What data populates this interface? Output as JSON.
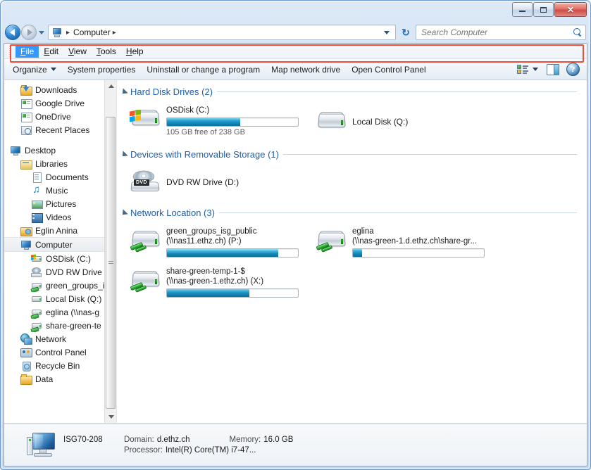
{
  "window": {
    "controls": {
      "minimize": "minimize-button",
      "maximize": "maximize-button",
      "close": "✕"
    }
  },
  "addressbar": {
    "back_tooltip": "Back",
    "forward_tooltip": "Forward",
    "crumb_root": "Computer",
    "refresh_glyph": "↻"
  },
  "search": {
    "placeholder": "Search Computer",
    "value": ""
  },
  "menubar": {
    "items": [
      {
        "label": "File",
        "accel": "F",
        "rest": "ile",
        "active": true
      },
      {
        "label": "Edit",
        "accel": "E",
        "rest": "dit",
        "active": false
      },
      {
        "label": "View",
        "accel": "V",
        "rest": "iew",
        "active": false
      },
      {
        "label": "Tools",
        "accel": "T",
        "rest": "ools",
        "active": false
      },
      {
        "label": "Help",
        "accel": "H",
        "rest": "elp",
        "active": false
      }
    ],
    "highlight_color": "#3399ff",
    "annotation_color": "#f04a3a"
  },
  "toolbar": {
    "organize": "Organize",
    "system_properties": "System properties",
    "uninstall": "Uninstall or change a program",
    "map_network_drive": "Map network drive",
    "open_control_panel": "Open Control Panel",
    "help_glyph": "?"
  },
  "sidebar": {
    "items": [
      {
        "label": "Downloads",
        "icon": "downloads-folder-icon",
        "indent": 1,
        "type": "dl"
      },
      {
        "label": "Google Drive",
        "icon": "google-drive-icon",
        "indent": 1,
        "type": "app"
      },
      {
        "label": "OneDrive",
        "icon": "onedrive-icon",
        "indent": 1,
        "type": "app"
      },
      {
        "label": "Recent Places",
        "icon": "recent-places-icon",
        "indent": 1,
        "type": "recent"
      },
      {
        "label": "",
        "icon": "",
        "indent": 0,
        "type": "gap"
      },
      {
        "label": "Desktop",
        "icon": "desktop-icon",
        "indent": 0,
        "type": "monitor"
      },
      {
        "label": "Libraries",
        "icon": "libraries-icon",
        "indent": 1,
        "type": "library"
      },
      {
        "label": "Documents",
        "icon": "documents-icon",
        "indent": 2,
        "type": "doc"
      },
      {
        "label": "Music",
        "icon": "music-icon",
        "indent": 2,
        "type": "music"
      },
      {
        "label": "Pictures",
        "icon": "pictures-icon",
        "indent": 2,
        "type": "pic"
      },
      {
        "label": "Videos",
        "icon": "videos-icon",
        "indent": 2,
        "type": "vid"
      },
      {
        "label": "Eglin  Anina",
        "icon": "user-folder-icon",
        "indent": 1,
        "type": "user"
      },
      {
        "label": "Computer",
        "icon": "computer-icon",
        "indent": 1,
        "type": "monitor",
        "selected": true
      },
      {
        "label": "OSDisk (C:)",
        "icon": "os-disk-icon",
        "indent": 2,
        "type": "hdd-win"
      },
      {
        "label": "DVD RW Drive (",
        "icon": "dvd-drive-icon",
        "indent": 2,
        "type": "dvd"
      },
      {
        "label": "green_groups_i",
        "icon": "network-drive-icon",
        "indent": 2,
        "type": "hdd-net"
      },
      {
        "label": "Local Disk (Q:)",
        "icon": "local-disk-icon",
        "indent": 2,
        "type": "hdd"
      },
      {
        "label": "eglina (\\\\nas-g",
        "icon": "network-drive-icon",
        "indent": 2,
        "type": "hdd-net"
      },
      {
        "label": "share-green-te",
        "icon": "network-drive-icon",
        "indent": 2,
        "type": "hdd-net"
      },
      {
        "label": "Network",
        "icon": "network-globe-icon",
        "indent": 1,
        "type": "globe"
      },
      {
        "label": "Control Panel",
        "icon": "control-panel-icon",
        "indent": 1,
        "type": "cpanel"
      },
      {
        "label": "Recycle Bin",
        "icon": "recycle-bin-icon",
        "indent": 1,
        "type": "bin"
      },
      {
        "label": "Data",
        "icon": "data-folder-icon",
        "indent": 1,
        "type": "folder"
      }
    ]
  },
  "content": {
    "sections": [
      {
        "title": "Hard Disk Drives (2)",
        "items": [
          {
            "name": "OSDisk (C:)",
            "icon": "os-disk-icon",
            "progress": 56,
            "sub": "105 GB free of 238 GB",
            "has_progress": true
          },
          {
            "name": "Local Disk (Q:)",
            "icon": "local-disk-icon",
            "has_progress": false
          }
        ]
      },
      {
        "title": "Devices with Removable Storage (1)",
        "items": [
          {
            "name": "DVD RW Drive (D:)",
            "icon": "dvd-drive-icon",
            "badge": "DVD",
            "has_progress": false
          }
        ]
      },
      {
        "title": "Network Location (3)",
        "items": [
          {
            "name": "green_groups_isg_public",
            "name2": "(\\\\nas11.ethz.ch) (P:)",
            "icon": "network-drive-icon",
            "progress": 85,
            "has_progress": true
          },
          {
            "name": "eglina",
            "name2": "(\\\\nas-green-1.d.ethz.ch\\share-gr...",
            "icon": "network-drive-icon",
            "progress": 7,
            "has_progress": true
          },
          {
            "name": "share-green-temp-1-$",
            "name2": "(\\\\nas-green-1.ethz.ch) (X:)",
            "icon": "network-drive-icon",
            "progress": 63,
            "has_progress": true
          }
        ]
      }
    ]
  },
  "details": {
    "computer_name": "ISG70-208",
    "domain_key": "Domain:",
    "domain_value": "d.ethz.ch",
    "memory_key": "Memory:",
    "memory_value": "16.0 GB",
    "processor_key": "Processor:",
    "processor_value": "Intel(R) Core(TM) i7-47..."
  }
}
